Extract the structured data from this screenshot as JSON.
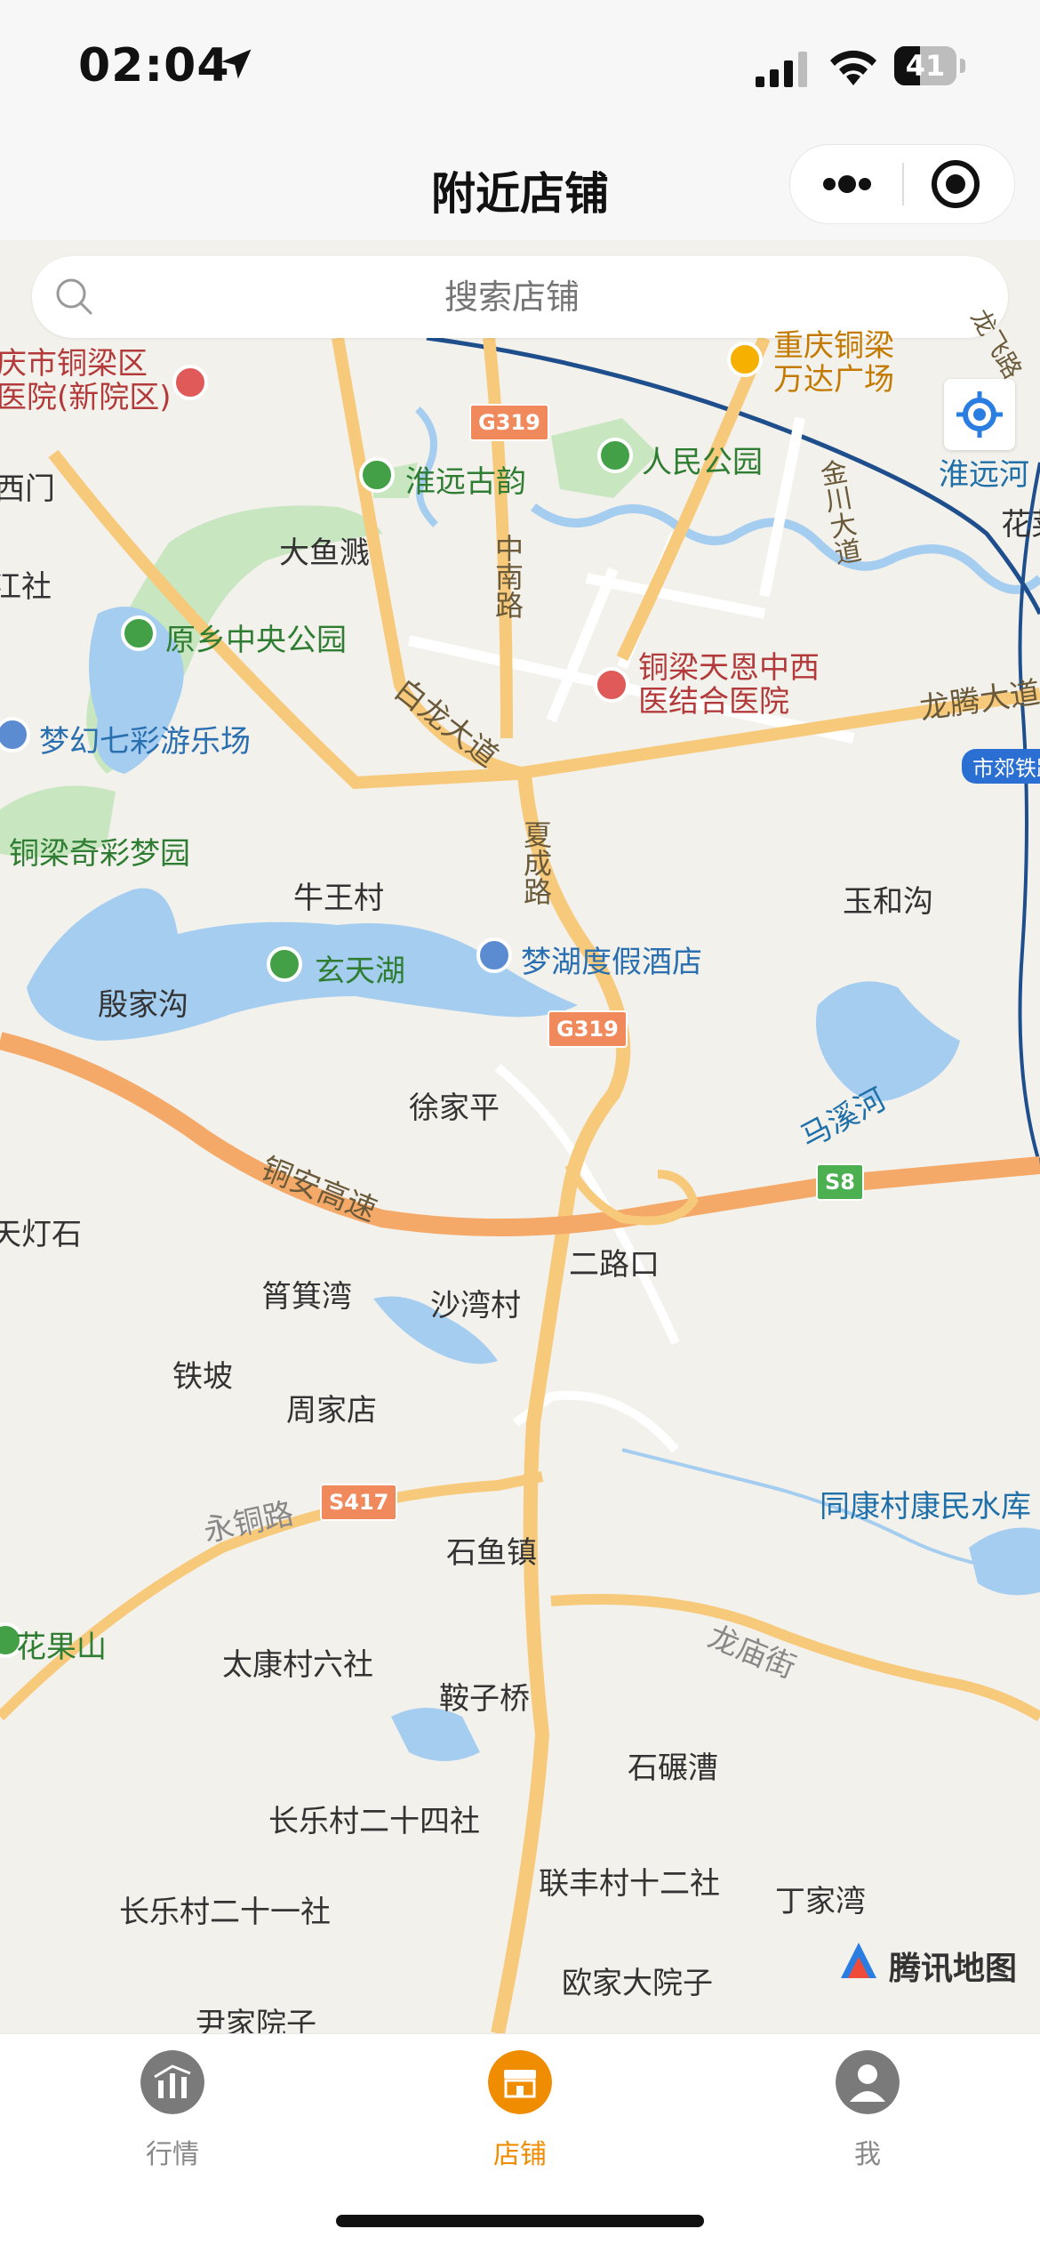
{
  "status_bar": {
    "time": "02:04",
    "battery": "41",
    "battery_level": 0.41
  },
  "header": {
    "title": "附近店铺"
  },
  "search": {
    "placeholder": "搜索店铺"
  },
  "map": {
    "attribution": "腾讯地图",
    "shields": [
      "G319",
      "G319",
      "S8",
      "S417"
    ],
    "labels": {
      "tongliang_hospital": "庆市铜梁区\n医院(新院区)",
      "ximen": "西门",
      "xi_ju": "江社",
      "wanda": "重庆铜梁\n万达广场",
      "longfei": "龙飞路",
      "huaiyuan_he": "淮远河",
      "hua_ying": "花荚",
      "huaiyuan_gu": "淮远古韵",
      "renmin_park": "人民公园",
      "jinchuan": "金川大道",
      "dayu": "大鱼溅",
      "zhongnan": "中南路",
      "yuanxiang": "原乡中央公园",
      "tianen": "铜梁天恩中西\n医结合医院",
      "longteng": "龙腾大道",
      "bailong": "白龙大道",
      "menghuan": "梦幻七彩游乐场",
      "shijiao": "市郊铁路",
      "qicai": "铜梁奇彩梦园",
      "xiacheng": "夏成路",
      "niuwang": "牛王村",
      "yuhegou": "玉和沟",
      "xuantian": "玄天湖",
      "menghu": "梦湖度假酒店",
      "yinjia": "殷家沟",
      "xujia": "徐家平",
      "maxi": "马溪河",
      "tongan": "铜安高速",
      "dengshi": "天灯石",
      "erlukou": "二路口",
      "yujiwan": "筲箕湾",
      "shawan": "沙湾村",
      "tiepo": "铁坡",
      "zhoujia": "周家店",
      "tongkang": "同康村康民水库",
      "yongtong": "永铜路",
      "shiyu": "石鱼镇",
      "huaguo": "花果山",
      "longmiao": "龙庙街",
      "taikang": "太康村六社",
      "anzi": "鞍子桥",
      "shinian": "石碾漕",
      "changle24": "长乐村二十四社",
      "lianfeng": "联丰村十二社",
      "dingjia": "丁家湾",
      "changle21": "长乐村二十一社",
      "oujia": "欧家大院子",
      "yinjia_yuan": "尹家院子"
    }
  },
  "tabs": [
    {
      "label": "行情",
      "active": false,
      "icon": "market-chart-icon"
    },
    {
      "label": "店铺",
      "active": true,
      "icon": "store-icon"
    },
    {
      "label": "我",
      "active": false,
      "icon": "user-icon"
    }
  ],
  "colors": {
    "accent": "#f08c00",
    "road_main": "#f7c97a",
    "highway": "#f4a968",
    "water": "#a5cdf0",
    "park": "#c8e6c0",
    "railway": "#1e4e8c"
  }
}
